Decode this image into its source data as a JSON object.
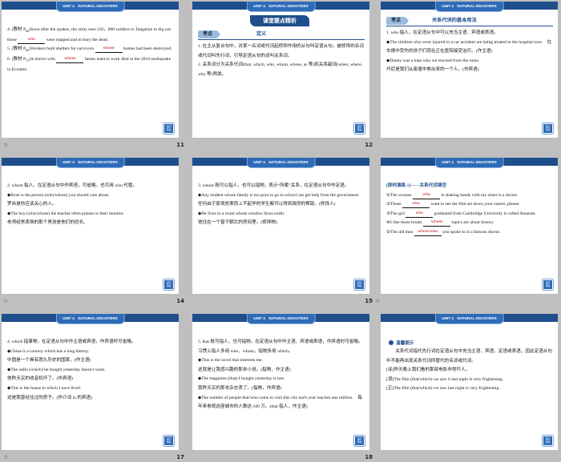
{
  "header_label": "UNIT 4　NATURAL DISASTERS",
  "side_button": [
    "返回",
    "导航"
  ],
  "star_glyph": "☆",
  "slides": [
    {
      "num": "10",
      "lines": [
        [
          "4. (教材 P",
          [
            "66"
          ],
          ")Soon after the quakes, the army sent 150，000 soldiers to Tangshan to dig out those ",
          {
            "b": "who"
          },
          " were trapped and to bury the dead."
        ],
        [
          "5. (教材 P",
          [
            "66"
          ],
          ")Workers built shelters for survivors ",
          {
            "b": "whose"
          },
          " homes had been destroyed."
        ],
        [
          "6. (教材 P",
          [
            "72"
          ],
          ")A doctor with ",
          {
            "b": "whom"
          },
          " James used to work died in the 2016 earthquake in Ecuador."
        ]
      ]
    },
    {
      "num": "11",
      "banner": "课堂要点精析",
      "kd": "考点",
      "kdtitle": "定义",
      "lines": [
        "1. 在主从复合句中，对某一名词或代词起修饰作用的从句叫定语从句。被修饰的名词或代词叫先行词，引导定语从句的词叫关系词。",
        "2. 关系词分为关系代词(that, which, who, whom, whose, as 等)和关系副词(when, where, why 等)两类。"
      ]
    },
    {
      "num": "12",
      "kd": "考点",
      "kdtitle": "关系代词的基本用法",
      "lines": [
        "1. who 指人，在定语从句中可以充当主语、宾语或表语。",
        "◆The children who were injured in a car accident are being treated in the hospital now.　在车祸中受伤的孩子们现在正在医院接受治疗。(作主语)",
        "◆Danny was a man who we rescued from the ruins.",
        "丹尼是我们从废墟中救出来的一个人。(作宾语)"
      ]
    },
    {
      "num": "13",
      "lines": [
        "2. whom 指人，在定语从句中作宾语，可省略，也可用 who 代替。",
        "◆Rose is the person (who/whom) you should care about.",
        "罗丝是你应该关心的人。",
        "◆The boy (who/whom) the teacher often praises is their monitor.",
        "老师经常表扬的那个男孩是他们的班长。"
      ]
    },
    {
      "num": "14",
      "lines": [
        "3. whose 既可以指人，也可以指物，表示“所属”关系，在定语从句中作定语。",
        "◆Any student whose family is too poor to go to school can get help from the government.",
        "任何由于家境贫寒而上不起学的学生都可以得到政府的帮助。(修饰人)",
        "◆He lives in a room whose window faces north.",
        "他住在一个窗子朝北的房间里。(修饰物)"
      ]
    },
    {
      "num": "15",
      "practice": "[即时演练 1]——关系代词填空",
      "lines": [
        [
          "①The woman ",
          {
            "b": "who"
          },
          " is shaking hands with my sister is a doctor."
        ],
        [
          "②Those ",
          {
            "b": "who"
          },
          " want to see the film set down your names, please."
        ],
        [
          "③The girl ",
          {
            "b": "who"
          },
          " graduated from Cambridge University is called Amanda."
        ],
        [
          "④I like those books ",
          {
            "b": "whose"
          },
          " topics are about history."
        ],
        [
          "⑤The old man ",
          {
            "b": "whom/who"
          },
          " you spoke to is a famous doctor."
        ]
      ]
    },
    {
      "num": "16",
      "lines": [
        "4. which 指事物，在定语从句中作主语或宾语，作宾语时可省略。",
        "◆China is a country which has a long history.",
        "中国是一个具有悠久历史的国家。(作主语)",
        "◆The radio (which) he bought yesterday doesn't work.",
        "他昨天买的收音机坏了。(作宾语)",
        "◆This is the house in which I once lived.",
        "这是我曾经住过的房子。(作介词 in 的宾语)"
      ]
    },
    {
      "num": "17",
      "lines": [
        "5. that 既可指人，也可指物。在定语从句中作主语、宾语或表语，作宾语时可省略。习惯上指人多用 who、whom，指物多用 which。",
        "◆This is the novel that interests me.",
        "这就是让我感兴趣的那本小说。(指物，作主语)",
        "◆The magazine (that) I bought yesterday is lost.",
        "我昨天买的那本杂志丢了。(指物，作宾语)",
        "◆The number of people that/who come to visit this city each year reaches one million.　每年来参观这座城市的人数达 100 万。(that 指人，作主语)"
      ]
    },
    {
      "num": "18",
      "tip": "温馨提示",
      "lines": [
        "　　关系代词指代先行词在定语从句中充当主语、宾语、定语或表语，因此定语从句中不能再出现关系代词所替代的名词或代词。",
        "[译]昨天晚上我们看的那部电影非常吓人。",
        "[误]The film (that/which) we saw it last night is very frightening.",
        "[正]The film (that/which) we saw last night is very frightening."
      ]
    }
  ]
}
